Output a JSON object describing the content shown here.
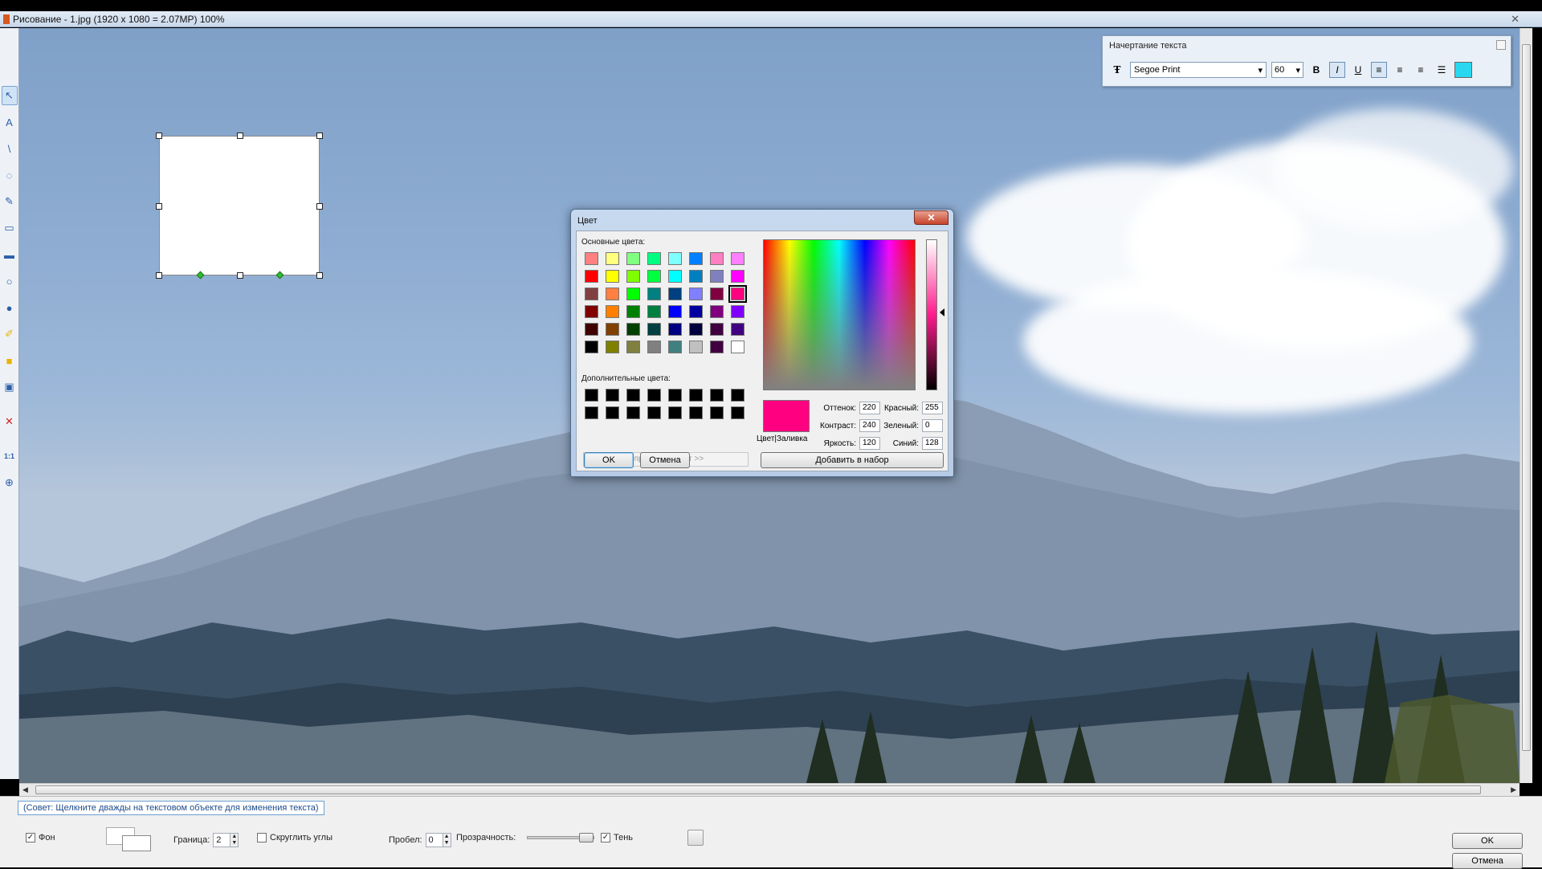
{
  "window": {
    "title": "Рисование  -  1.jpg  (1920 x 1080 = 2.07MP)   100%",
    "close_glyph": "✕"
  },
  "text_panel": {
    "title": "Начертание текста",
    "font": "Segoe Print",
    "size": "60",
    "bold": "B",
    "italic": "I",
    "underline": "U",
    "text_color": "#29d8f0"
  },
  "color_dialog": {
    "title": "Цвет",
    "close_glyph": "✕",
    "basic_colors_label": "Основные цвета:",
    "custom_colors_label": "Дополнительные цвета:",
    "define_button": "Определить цвет >>",
    "ok_button": "OK",
    "cancel_button": "Отмена",
    "add_button": "Добавить в набор",
    "preview_label": "Цвет|Заливка",
    "current_color": "#ff0080",
    "basic_colors": [
      "#ff8080",
      "#ffff80",
      "#80ff80",
      "#00ff80",
      "#80ffff",
      "#0080ff",
      "#ff80c0",
      "#ff80ff",
      "#ff0000",
      "#ffff00",
      "#80ff00",
      "#00ff40",
      "#00ffff",
      "#0080c0",
      "#8080c0",
      "#ff00ff",
      "#804040",
      "#ff8040",
      "#00ff00",
      "#008080",
      "#004080",
      "#8080ff",
      "#800040",
      "#ff0080",
      "#800000",
      "#ff8000",
      "#008000",
      "#008040",
      "#0000ff",
      "#0000a0",
      "#800080",
      "#8000ff",
      "#400000",
      "#804000",
      "#004000",
      "#004040",
      "#000080",
      "#000040",
      "#400040",
      "#400080",
      "#000000",
      "#808000",
      "#808040",
      "#808080",
      "#408080",
      "#c0c0c0",
      "#400040",
      "#ffffff"
    ],
    "selected_basic_index": 23,
    "custom_colors": [
      "#000000",
      "#000000",
      "#000000",
      "#000000",
      "#000000",
      "#000000",
      "#000000",
      "#000000",
      "#000000",
      "#000000",
      "#000000",
      "#000000",
      "#000000",
      "#000000",
      "#000000",
      "#000000"
    ],
    "fields": {
      "hue_label": "Оттенок:",
      "hue": "220",
      "sat_label": "Контраст:",
      "sat": "240",
      "lum_label": "Яркость:",
      "lum": "120",
      "red_label": "Красный:",
      "red": "255",
      "green_label": "Зеленый:",
      "green": "0",
      "blue_label": "Синий:",
      "blue": "128"
    }
  },
  "bottom": {
    "hint": "(Совет: Щелкните дважды на текстовом объекте для изменения текста)",
    "background_label": "Фон",
    "border_label": "Граница:",
    "border_value": "2",
    "round_corners_label": "Скруглить углы",
    "padding_label": "Пробел:",
    "padding_value": "0",
    "opacity_label": "Прозрачность:",
    "opacity": 1.0,
    "shadow_label": "Тень",
    "ok_button": "OK",
    "cancel_button": "Отмена"
  },
  "left_tools": [
    {
      "name": "select-tool-icon",
      "glyph": "↖"
    },
    {
      "name": "text-tool-icon",
      "glyph": "A"
    },
    {
      "name": "line-tool-icon",
      "glyph": "\\"
    },
    {
      "name": "lasso-tool-icon",
      "glyph": "◌"
    },
    {
      "name": "pen-tool-icon",
      "glyph": "✎"
    },
    {
      "name": "rectangle-tool-icon",
      "glyph": "▭"
    },
    {
      "name": "filled-rectangle-tool-icon",
      "glyph": "▬"
    },
    {
      "name": "ellipse-tool-icon",
      "glyph": "○"
    },
    {
      "name": "filled-ellipse-tool-icon",
      "glyph": "●"
    },
    {
      "name": "highlighter-tool-icon",
      "glyph": "✐"
    },
    {
      "name": "fill-tool-icon",
      "glyph": "■"
    },
    {
      "name": "image-tool-icon",
      "glyph": "▣"
    },
    {
      "name": "delete-tool-icon",
      "glyph": "✕"
    },
    {
      "name": "actual-size-icon",
      "glyph": "1:1"
    },
    {
      "name": "zoom-fit-icon",
      "glyph": "⊕"
    }
  ]
}
